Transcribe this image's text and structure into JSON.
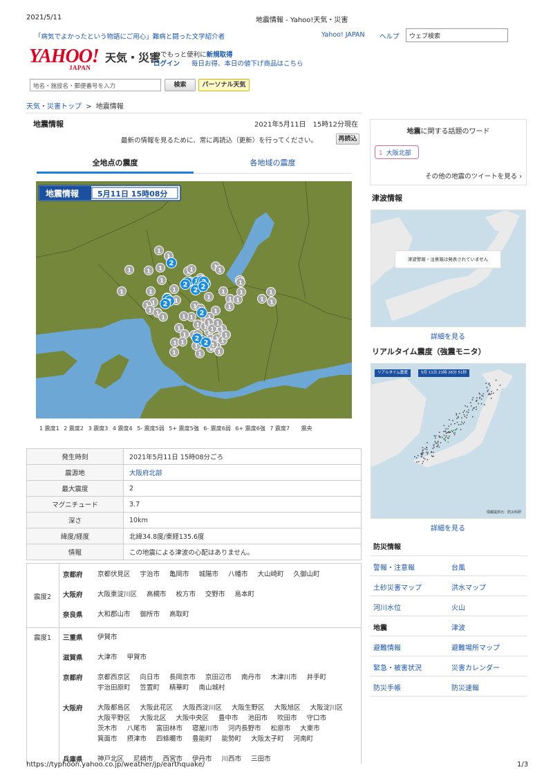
{
  "print_header": {
    "date": "2021/5/11",
    "title": "地震情報 - Yahoo!天気・災害"
  },
  "top": {
    "topic": "「病気でよかったという物語にご用心」難病と闘った文学紹介者",
    "yahoo_japan": "Yahoo! JAPAN",
    "help": "ヘルプ",
    "web_search": "ウェブ検索"
  },
  "logo": {
    "main": "YAHOO!",
    "sub": "JAPAN",
    "service": "天気・災害"
  },
  "login": {
    "line1_prefix": "IDでもっと便利に",
    "register": "新規取得",
    "login": "ログイン",
    "promo": "毎日お得、本日の値下げ商品はこちら"
  },
  "search": {
    "placeholder": "地名・施設名・郵便番号を入力",
    "button": "検索",
    "personal": "パーソナル天気"
  },
  "breadcrumb": {
    "home": "天気・災害トップ",
    "sep": ">",
    "current": "地震情報"
  },
  "main": {
    "title": "地震情報",
    "updated": "2021年5月11日　15時12分現在",
    "reload_note": "最新の情報を見るために、常に再読込（更新）を行ってください。",
    "reload_button": "再読込",
    "tabs": [
      "全地点の震度",
      "各地域の震度"
    ]
  },
  "map": {
    "badge_title": "地震情報",
    "badge_time": "5月11日 15時08分",
    "colors": {
      "land": "#74873a",
      "water": "#6ca7d6",
      "marker_1": "#a8a8a8",
      "marker_2": "#1a8ce0"
    }
  },
  "legend": [
    "1 震度1",
    "2 震度2",
    "3 震度3",
    "4 震度4",
    "5- 震度5弱",
    "5+ 震度5強",
    "6- 震度6弱",
    "6+ 震度6強",
    "7 震度7",
    "震央"
  ],
  "info": [
    {
      "key": "発生時刻",
      "value": "2021年5月11日 15時08分ごろ"
    },
    {
      "key": "震源地",
      "value": "大阪府北部",
      "link": true
    },
    {
      "key": "最大震度",
      "value": "2"
    },
    {
      "key": "マグニチュード",
      "value": "3.7"
    },
    {
      "key": "深さ",
      "value": "10km"
    },
    {
      "key": "緯度/経度",
      "value": "北緯34.8度/東経135.6度"
    },
    {
      "key": "情報",
      "value": "この地震による津波の心配はありません。"
    }
  ],
  "shindo": {
    "level2": {
      "label": "震度2",
      "groups": [
        {
          "pref": "京都府",
          "cities": [
            "京都伏見区",
            "宇治市",
            "亀岡市",
            "城陽市",
            "八幡市",
            "大山崎町",
            "久御山町"
          ]
        },
        {
          "pref": "大阪府",
          "cities": [
            "大阪東淀川区",
            "高槻市",
            "枚方市",
            "交野市",
            "島本町"
          ]
        },
        {
          "pref": "奈良県",
          "cities": [
            "大和郡山市",
            "御所市",
            "高取町"
          ]
        }
      ]
    },
    "level1": {
      "label": "震度1",
      "groups": [
        {
          "pref": "三重県",
          "cities": [
            "伊賀市"
          ]
        },
        {
          "pref": "滋賀県",
          "cities": [
            "大津市",
            "甲賀市"
          ]
        },
        {
          "pref": "京都府",
          "cities": [
            "京都西京区",
            "向日市",
            "長岡京市",
            "京田辺市",
            "南丹市",
            "木津川市",
            "井手町",
            "宇治田原町",
            "笠置町",
            "精華町",
            "南山城村"
          ]
        },
        {
          "pref": "大阪府",
          "cities": [
            "大阪都島区",
            "大阪此花区",
            "大阪西淀川区",
            "大阪生野区",
            "大阪旭区",
            "大阪淀川区",
            "大阪平野区",
            "大阪北区",
            "大阪中央区",
            "豊中市",
            "池田市",
            "吹田市",
            "守口市",
            "茨木市",
            "八尾市",
            "富田林市",
            "寝屋川市",
            "河内長野市",
            "松原市",
            "大東市",
            "箕面市",
            "摂津市",
            "四條畷市",
            "豊能町",
            "能勢町",
            "大阪太子町",
            "河南町"
          ]
        },
        {
          "pref": "兵庫県",
          "cities": [
            "神戸北区",
            "尼崎市",
            "西宮市",
            "伊丹市",
            "川西市",
            "三田市"
          ]
        }
      ]
    }
  },
  "sidebar": {
    "trend_title_bold": "地震",
    "trend_title_rest": "に関する話題のワード",
    "trend_rank": "1",
    "trend_word": "大阪北部",
    "more_tweets": "その他の地震のツイートを見る",
    "tsunami_title": "津波情報",
    "tsunami_note": "津波警報・注意報は発表されていません",
    "detail_link": "詳細を見る",
    "realtime_title": "リアルタイム震度（強震モニタ）",
    "realtime_badge": "リアルタイム震度",
    "realtime_time": "5月 11日 21時 26分 51秒",
    "realtime_credit": "情報提供元：防災科研",
    "disaster_title": "防災情報",
    "disaster_links": [
      [
        "警報・注意報",
        "台風"
      ],
      [
        "土砂災害マップ",
        "洪水マップ"
      ],
      [
        "河川水位",
        "火山"
      ],
      [
        "地震",
        "津波"
      ],
      [
        "避難情報",
        "避難場所マップ"
      ],
      [
        "緊急・被害状況",
        "災害カレンダー"
      ],
      [
        "防災手帳",
        "防災速報"
      ]
    ]
  },
  "footer": {
    "url": "https://typhoon.yahoo.co.jp/weather/jp/earthquake/",
    "page": "1/3"
  }
}
